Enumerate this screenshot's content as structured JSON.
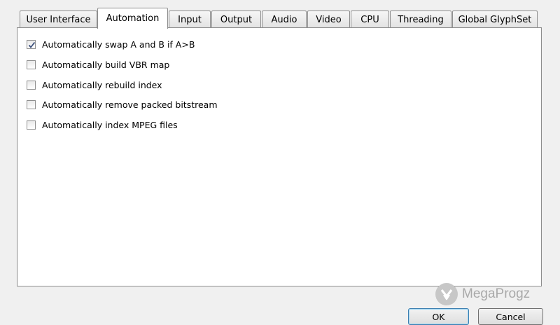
{
  "tabs": [
    {
      "label": "User Interface",
      "active": false
    },
    {
      "label": "Automation",
      "active": true
    },
    {
      "label": "Input",
      "active": false
    },
    {
      "label": "Output",
      "active": false
    },
    {
      "label": "Audio",
      "active": false
    },
    {
      "label": "Video",
      "active": false
    },
    {
      "label": "CPU",
      "active": false
    },
    {
      "label": "Threading",
      "active": false
    },
    {
      "label": "Global GlyphSet",
      "active": false
    }
  ],
  "options": [
    {
      "label": "Automatically swap A and B if A>B",
      "checked": true
    },
    {
      "label": "Automatically build VBR map",
      "checked": false
    },
    {
      "label": "Automatically rebuild index",
      "checked": false
    },
    {
      "label": "Automatically remove packed bitstream",
      "checked": false
    },
    {
      "label": "Automatically index MPEG files",
      "checked": false
    }
  ],
  "buttons": {
    "ok": "OK",
    "cancel": "Cancel"
  },
  "watermark": {
    "text": "MegaProgz"
  },
  "colors": {
    "panel_border": "#8d8d8d",
    "window_bg": "#f0f0f0",
    "default_button_border": "#3c7fb1"
  }
}
